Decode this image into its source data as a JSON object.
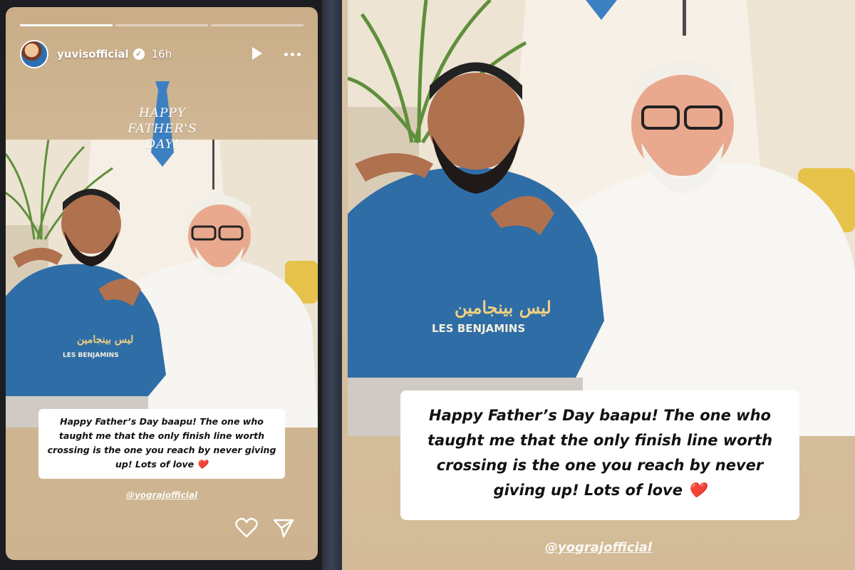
{
  "story": {
    "username": "yuvisofficial",
    "time_ago": "16h",
    "progress_segments": 3,
    "active_segment": 0,
    "sticker_lines": [
      "HAPPY",
      "FATHER'S",
      "DAY!"
    ],
    "caption": "Happy Father’s Day baapu! The one who taught me that the only finish line worth crossing is the one you reach by never giving up! Lots of love ❤️",
    "mention": "@yograjofficial"
  },
  "icons": {
    "verified": "verified-badge-icon",
    "play": "play-icon",
    "more": "more-icon",
    "like": "heart-icon",
    "share": "send-icon"
  },
  "colors": {
    "story_bg": "#cdb38f",
    "tie_blue": "#3d80c2",
    "tshirt_blue": "#2f6da6"
  }
}
